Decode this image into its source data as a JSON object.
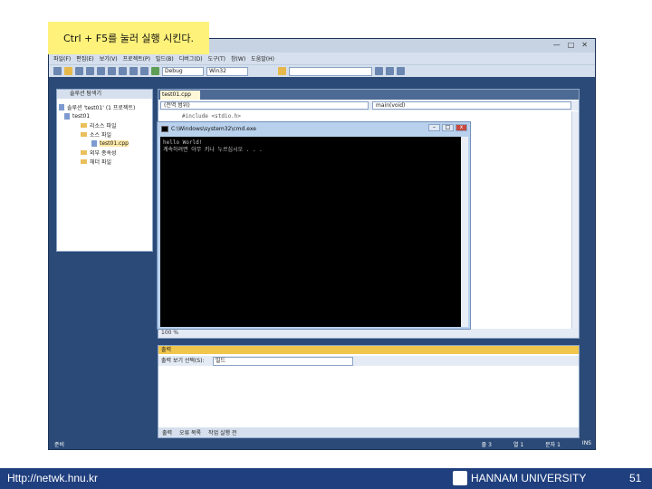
{
  "note": {
    "text": "Ctrl + F5를 눌러 실행 시킨다."
  },
  "ide": {
    "window_controls": [
      "—",
      "□",
      "✕"
    ],
    "menu": [
      "파일(F)",
      "편집(E)",
      "보기(V)",
      "프로젝트(P)",
      "빌드(B)",
      "디버그(D)",
      "도구(T)",
      "창(W)",
      "도움말(H)"
    ],
    "toolbar": {
      "config": "Debug",
      "platform": "Win32"
    },
    "solution_explorer": {
      "title": "솔루션 탐색기",
      "items": [
        {
          "label": "솔루션 'test01' (1 프로젝트)"
        },
        {
          "label": "test01"
        },
        {
          "label": "리소스 파일"
        },
        {
          "label": "소스 파일"
        },
        {
          "label": "test01.cpp"
        },
        {
          "label": "외부 종속성"
        },
        {
          "label": "헤더 파일"
        }
      ]
    },
    "editor": {
      "tab": "test01.cpp",
      "scope": "(전역 범위)",
      "function": "main(void)",
      "first_line": "#include <stdio.h>",
      "zoom": "100 %"
    },
    "console": {
      "title": "C:\\Windows\\system32\\cmd.exe",
      "lines": [
        "hello World!",
        "계속하려면 아무 키나 누르십시오 . . ."
      ]
    },
    "output": {
      "title": "출력",
      "source_label": "출력 보기 선택(S):",
      "source_value": "빌드",
      "tabs": [
        "출력",
        "오류 목록",
        "작업 실행 전"
      ]
    },
    "status": {
      "ready": "준비",
      "line": "줄 3",
      "col": "열 1",
      "ch": "문자 1",
      "mode": "INS"
    }
  },
  "footer": {
    "url": "Http://netwk.hnu.kr",
    "university": "HANNAM UNIVERSITY",
    "page": "51"
  }
}
